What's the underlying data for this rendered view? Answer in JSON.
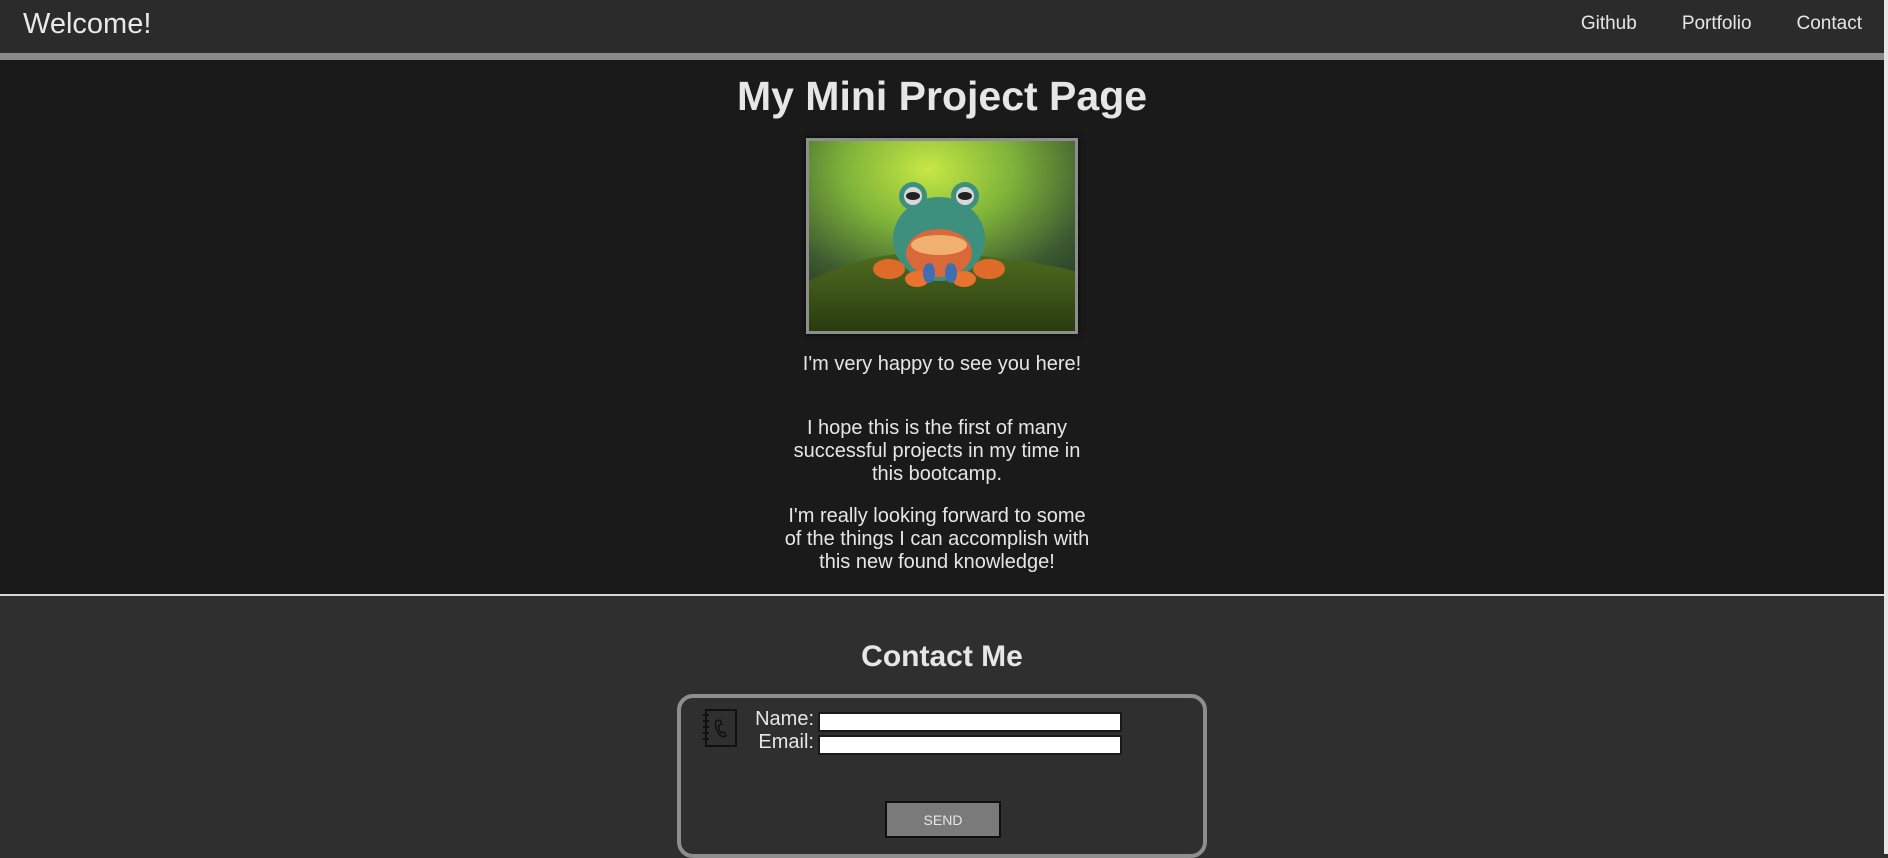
{
  "header": {
    "brand": "Welcome!",
    "nav": [
      {
        "label": "Github"
      },
      {
        "label": "Portfolio"
      },
      {
        "label": "Contact"
      }
    ]
  },
  "main": {
    "title": "My Mini Project Page",
    "image_icon": "frog-photo",
    "greeting": "I'm very happy to see you here!",
    "paragraph_1": "I hope this is the first of many successful projects in my time in this bootcamp.",
    "paragraph_2": "I'm really looking forward to some of the things I can accomplish with this new found knowledge!"
  },
  "contact": {
    "title": "Contact Me",
    "icon": "phonebook-icon",
    "name_label": "Name:",
    "email_label": "Email:",
    "name_value": "",
    "email_value": "",
    "send_label": "SEND"
  },
  "colors": {
    "header_bg": "#2b2b2b",
    "main_bg": "#1b1a1b",
    "contact_bg": "#2f2f2f",
    "border_gray": "#8e8e8e",
    "text": "#e6e6e6"
  }
}
